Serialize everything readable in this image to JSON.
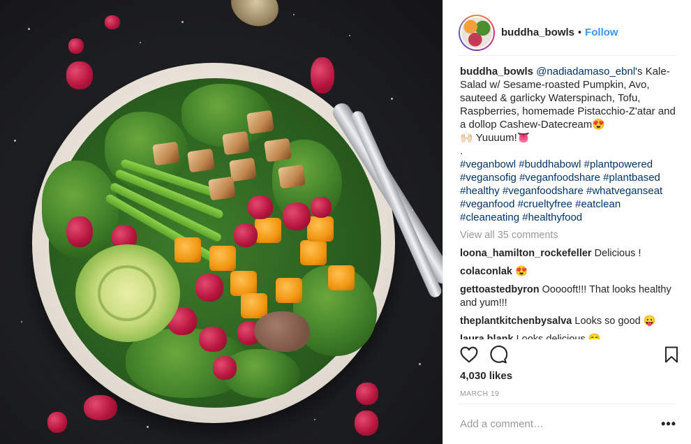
{
  "post": {
    "photo_alt": "",
    "account": {
      "username": "buddha_bowls",
      "separator": "•",
      "follow_label": "Follow"
    },
    "caption": {
      "username": "buddha_bowls",
      "mention": "@nadiadamaso_ebnl",
      "text": "'s Kale-Salad w/ Sesame-roasted Pumpkin, Avo, sauteed & garlicky Waterspinach, Tofu, Raspberries, homemade Pistacchio-Z'atar and a dollop Cashew-Datecream😍",
      "line2": "🙌🏻  Yuuuum!👅",
      "line3": ".",
      "hashtags": "#veganbowl #buddhabowl #plantpowered #vegansofig #veganfoodshare #plantbased #healthy #veganfoodshare #whatveganseat #veganfood #crueltyfree #eatclean #cleaneating #healthyfood"
    },
    "view_all": "View all 35 comments",
    "comments": [
      {
        "user": "loona_hamilton_rockefeller",
        "text": "Delicious !"
      },
      {
        "user": "colaconlak",
        "text": "😍"
      },
      {
        "user": "gettoastedbyron",
        "text": "Oooooft!!! That looks healthy and yum!!!"
      },
      {
        "user": "theplantkitchenbysalva",
        "text": "Looks so good 😛"
      },
      {
        "user": "laura.blank",
        "text": "Looks delicious 😋"
      }
    ],
    "actions": {
      "like_icon": "heart-icon",
      "comment_icon": "comment-icon",
      "save_icon": "bookmark-icon"
    },
    "likes": "4,030 likes",
    "date": "MARCH 19",
    "add_comment_placeholder": "Add a comment…",
    "more_label": "•••"
  }
}
